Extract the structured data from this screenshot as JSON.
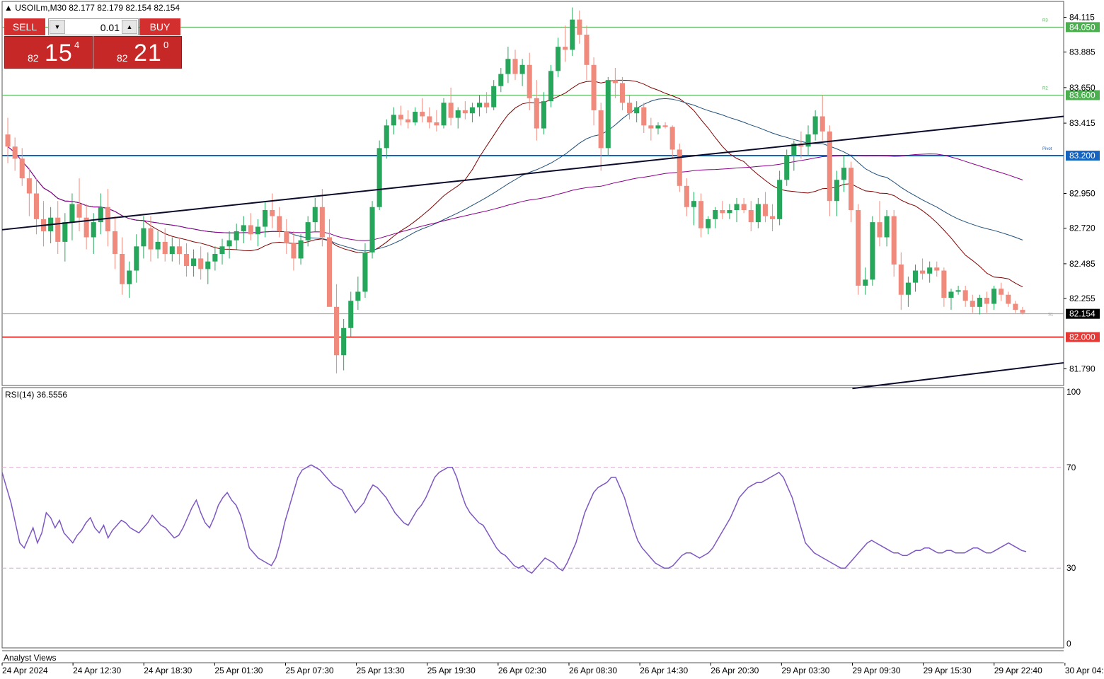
{
  "header": {
    "symbol_line": "USOILm,M30  82.177 82.179 82.154 82.154",
    "triangle_icon": "triangle-up-icon"
  },
  "trade_panel": {
    "sell_label": "SELL",
    "buy_label": "BUY",
    "volume": "0.01",
    "sell_price": {
      "small": "82",
      "big": "15",
      "sup": "4"
    },
    "buy_price": {
      "small": "82",
      "big": "21",
      "sup": "0"
    },
    "colors": {
      "button": "#d32f2f",
      "price_box": "#c62828"
    }
  },
  "indicator": {
    "rsi_label": "RSI(14) 36.5556"
  },
  "footer": {
    "analyst_label": "Analyst Views"
  },
  "chart_data": {
    "type": "candlestick",
    "symbol": "USOILm",
    "timeframe": "M30",
    "ylim": [
      81.68,
      84.22
    ],
    "y_ticks": [
      "84.115",
      "83.885",
      "83.650",
      "83.415",
      "82.950",
      "82.720",
      "82.485",
      "82.255",
      "81.790"
    ],
    "x_labels": [
      "24 Apr 2024",
      "24 Apr 12:30",
      "24 Apr 18:30",
      "25 Apr 01:30",
      "25 Apr 07:30",
      "25 Apr 13:30",
      "25 Apr 19:30",
      "26 Apr 02:30",
      "26 Apr 08:30",
      "26 Apr 14:30",
      "26 Apr 20:30",
      "29 Apr 03:30",
      "29 Apr 09:30",
      "29 Apr 15:30",
      "29 Apr 22:40",
      "30 Apr 04:30"
    ],
    "candle_count": 248,
    "candles_ohlc": [
      [
        83.34,
        83.45,
        83.15,
        83.26
      ],
      [
        83.26,
        83.32,
        83.1,
        83.18
      ],
      [
        83.18,
        83.25,
        83.0,
        83.05
      ],
      [
        83.05,
        83.12,
        82.8,
        82.95
      ],
      [
        82.95,
        83.05,
        82.68,
        82.78
      ],
      [
        82.78,
        82.9,
        82.6,
        82.7
      ],
      [
        82.7,
        82.86,
        82.62,
        82.79
      ],
      [
        82.79,
        82.9,
        82.55,
        82.63
      ],
      [
        82.63,
        82.82,
        82.5,
        82.76
      ],
      [
        82.76,
        82.95,
        82.64,
        82.88
      ],
      [
        82.88,
        83.05,
        82.7,
        82.79
      ],
      [
        82.79,
        82.88,
        82.58,
        82.66
      ],
      [
        82.66,
        82.82,
        82.55,
        82.76
      ],
      [
        82.76,
        82.95,
        82.68,
        82.86
      ],
      [
        82.86,
        82.98,
        82.6,
        82.7
      ],
      [
        82.7,
        82.8,
        82.45,
        82.55
      ],
      [
        82.55,
        82.66,
        82.28,
        82.35
      ],
      [
        82.35,
        82.5,
        82.26,
        82.44
      ],
      [
        82.44,
        82.68,
        82.36,
        82.6
      ],
      [
        82.6,
        82.8,
        82.52,
        82.72
      ],
      [
        82.72,
        82.8,
        82.5,
        82.58
      ],
      [
        82.58,
        82.7,
        82.52,
        82.63
      ],
      [
        82.63,
        82.72,
        82.5,
        82.55
      ],
      [
        82.55,
        82.66,
        82.5,
        82.6
      ],
      [
        82.6,
        82.66,
        82.48,
        82.55
      ],
      [
        82.55,
        82.62,
        82.4,
        82.47
      ],
      [
        82.47,
        82.58,
        82.4,
        82.52
      ],
      [
        82.52,
        82.6,
        82.38,
        82.45
      ],
      [
        82.45,
        82.56,
        82.35,
        82.5
      ],
      [
        82.5,
        82.6,
        82.44,
        82.55
      ],
      [
        82.55,
        82.65,
        82.48,
        82.6
      ],
      [
        82.6,
        82.7,
        82.52,
        82.64
      ],
      [
        82.64,
        82.75,
        82.58,
        82.7
      ],
      [
        82.7,
        82.8,
        82.62,
        82.74
      ],
      [
        82.74,
        82.82,
        82.64,
        82.68
      ],
      [
        82.68,
        82.78,
        82.6,
        82.73
      ],
      [
        82.73,
        82.9,
        82.66,
        82.84
      ],
      [
        82.84,
        82.95,
        82.72,
        82.8
      ],
      [
        82.8,
        82.86,
        82.66,
        82.7
      ],
      [
        82.7,
        82.78,
        82.55,
        82.62
      ],
      [
        82.62,
        82.7,
        82.44,
        82.52
      ],
      [
        82.52,
        82.68,
        82.48,
        82.64
      ],
      [
        82.64,
        82.8,
        82.6,
        82.76
      ],
      [
        82.76,
        82.92,
        82.7,
        82.86
      ],
      [
        82.86,
        82.98,
        82.6,
        82.66
      ],
      [
        82.66,
        82.78,
        82.3,
        82.2
      ],
      [
        82.2,
        82.35,
        81.76,
        81.88
      ],
      [
        81.88,
        82.12,
        81.78,
        82.06
      ],
      [
        82.06,
        82.3,
        82.0,
        82.24
      ],
      [
        82.24,
        82.4,
        82.18,
        82.3
      ],
      [
        82.3,
        82.62,
        82.26,
        82.56
      ],
      [
        82.56,
        82.9,
        82.52,
        82.86
      ],
      [
        82.86,
        83.3,
        82.84,
        83.25
      ],
      [
        83.25,
        83.44,
        83.18,
        83.4
      ],
      [
        83.4,
        83.52,
        83.34,
        83.47
      ],
      [
        83.47,
        83.53,
        83.4,
        83.44
      ],
      [
        83.44,
        83.5,
        83.38,
        83.42
      ],
      [
        83.42,
        83.52,
        83.4,
        83.49
      ],
      [
        83.49,
        83.58,
        83.42,
        83.46
      ],
      [
        83.46,
        83.52,
        83.38,
        83.42
      ],
      [
        83.42,
        83.5,
        83.36,
        83.4
      ],
      [
        83.4,
        83.58,
        83.38,
        83.55
      ],
      [
        83.55,
        83.65,
        83.4,
        83.45
      ],
      [
        83.45,
        83.52,
        83.38,
        83.5
      ],
      [
        83.5,
        83.56,
        83.44,
        83.48
      ],
      [
        83.48,
        83.55,
        83.42,
        83.52
      ],
      [
        83.52,
        83.6,
        83.46,
        83.55
      ],
      [
        83.55,
        83.62,
        83.48,
        83.52
      ],
      [
        83.52,
        83.7,
        83.5,
        83.66
      ],
      [
        83.66,
        83.78,
        83.62,
        83.74
      ],
      [
        83.74,
        83.92,
        83.68,
        83.84
      ],
      [
        83.84,
        83.9,
        83.7,
        83.74
      ],
      [
        83.74,
        83.84,
        83.66,
        83.8
      ],
      [
        83.8,
        83.88,
        83.5,
        83.58
      ],
      [
        83.58,
        83.7,
        83.3,
        83.38
      ],
      [
        83.38,
        83.62,
        83.34,
        83.56
      ],
      [
        83.56,
        83.8,
        83.52,
        83.76
      ],
      [
        83.76,
        83.98,
        83.72,
        83.92
      ],
      [
        83.92,
        84.06,
        83.82,
        83.9
      ],
      [
        83.9,
        84.18,
        83.86,
        84.1
      ],
      [
        84.1,
        84.16,
        83.94,
        84.0
      ],
      [
        84.0,
        84.06,
        83.7,
        83.8
      ],
      [
        83.8,
        83.85,
        83.4,
        83.5
      ],
      [
        83.5,
        83.55,
        83.1,
        83.25
      ],
      [
        83.25,
        83.72,
        83.2,
        83.7
      ],
      [
        83.7,
        83.78,
        83.58,
        83.68
      ],
      [
        83.68,
        83.72,
        83.5,
        83.55
      ],
      [
        83.55,
        83.6,
        83.44,
        83.48
      ],
      [
        83.48,
        83.56,
        83.42,
        83.52
      ],
      [
        83.52,
        83.55,
        83.35,
        83.4
      ],
      [
        83.4,
        83.45,
        83.3,
        83.38
      ],
      [
        83.38,
        83.42,
        83.34,
        83.4
      ],
      [
        83.4,
        83.42,
        83.38,
        83.39
      ],
      [
        83.39,
        83.4,
        83.18,
        83.24
      ],
      [
        83.24,
        83.28,
        82.96,
        83.0
      ],
      [
        83.0,
        83.05,
        82.8,
        82.86
      ],
      [
        82.86,
        82.96,
        82.74,
        82.9
      ],
      [
        82.9,
        82.95,
        82.66,
        82.72
      ],
      [
        82.72,
        82.8,
        82.68,
        82.78
      ],
      [
        82.78,
        82.86,
        82.72,
        82.84
      ],
      [
        82.84,
        82.9,
        82.78,
        82.82
      ],
      [
        82.82,
        82.88,
        82.78,
        82.84
      ],
      [
        82.84,
        82.92,
        82.76,
        82.88
      ],
      [
        82.88,
        82.92,
        82.82,
        82.84
      ],
      [
        82.84,
        82.9,
        82.7,
        82.76
      ],
      [
        82.76,
        82.92,
        82.72,
        82.88
      ],
      [
        82.88,
        82.96,
        82.76,
        82.8
      ],
      [
        82.8,
        82.88,
        82.7,
        82.78
      ],
      [
        82.78,
        83.1,
        82.74,
        83.04
      ],
      [
        83.04,
        83.24,
        83.0,
        83.2
      ],
      [
        83.2,
        83.3,
        83.1,
        83.28
      ],
      [
        83.28,
        83.36,
        83.18,
        83.26
      ],
      [
        83.26,
        83.4,
        83.2,
        83.34
      ],
      [
        83.34,
        83.5,
        83.3,
        83.46
      ],
      [
        83.46,
        83.6,
        83.3,
        83.36
      ],
      [
        83.36,
        83.4,
        82.8,
        82.9
      ],
      [
        82.9,
        83.1,
        82.8,
        83.04
      ],
      [
        83.04,
        83.2,
        82.96,
        83.12
      ],
      [
        83.12,
        83.16,
        82.76,
        82.84
      ],
      [
        82.84,
        82.88,
        82.28,
        82.34
      ],
      [
        82.34,
        82.46,
        82.28,
        82.38
      ],
      [
        82.38,
        82.8,
        82.34,
        82.76
      ],
      [
        82.76,
        82.9,
        82.6,
        82.66
      ],
      [
        82.66,
        82.84,
        82.6,
        82.8
      ],
      [
        82.8,
        82.84,
        82.4,
        82.48
      ],
      [
        82.48,
        82.56,
        82.18,
        82.28
      ],
      [
        82.28,
        82.4,
        82.2,
        82.36
      ],
      [
        82.36,
        82.48,
        82.3,
        82.44
      ],
      [
        82.44,
        82.52,
        82.38,
        82.42
      ],
      [
        82.42,
        82.5,
        82.36,
        82.46
      ],
      [
        82.46,
        82.5,
        82.4,
        82.44
      ],
      [
        82.44,
        82.46,
        82.2,
        82.26
      ],
      [
        82.26,
        82.32,
        82.18,
        82.3
      ],
      [
        82.3,
        82.34,
        82.28,
        82.31
      ],
      [
        82.31,
        82.34,
        82.2,
        82.24
      ],
      [
        82.24,
        82.28,
        82.16,
        82.2
      ],
      [
        82.2,
        82.28,
        82.15,
        82.26
      ],
      [
        82.26,
        82.3,
        82.16,
        82.22
      ],
      [
        82.22,
        82.34,
        82.18,
        82.32
      ],
      [
        82.32,
        82.36,
        82.24,
        82.28
      ],
      [
        82.28,
        82.3,
        82.2,
        82.22
      ],
      [
        82.22,
        82.24,
        82.16,
        82.18
      ],
      [
        82.18,
        82.2,
        82.15,
        82.16
      ]
    ],
    "levels": [
      {
        "label": "84.050",
        "value": 84.05,
        "color": "#4caf50",
        "tag": "R3"
      },
      {
        "label": "83.600",
        "value": 83.6,
        "color": "#4caf50",
        "tag": "R2"
      },
      {
        "label": "83.200",
        "value": 83.2,
        "color": "#1565c0",
        "tag": "Pivot"
      },
      {
        "label": "82.000",
        "value": 82.0,
        "color": "#e53935",
        "tag": ""
      }
    ],
    "current_price": {
      "label": "82.154",
      "value": 82.154,
      "tag": "S1"
    },
    "rsi": {
      "period": 14,
      "ylim": [
        0,
        100
      ],
      "levels": [
        70,
        30
      ],
      "y_ticks": [
        "100",
        "70",
        "30",
        "0"
      ],
      "values": [
        68,
        62,
        56,
        48,
        40,
        38,
        42,
        46,
        40,
        44,
        52,
        50,
        46,
        49,
        44,
        42,
        40,
        43,
        45,
        48,
        50,
        46,
        44,
        47,
        42,
        45,
        47,
        49,
        48,
        46,
        45,
        44,
        46,
        48,
        51,
        49,
        47,
        46,
        44,
        42,
        43,
        46,
        50,
        54,
        57,
        52,
        48,
        46,
        50,
        55,
        58,
        60,
        57,
        55,
        51,
        45,
        38,
        36,
        34,
        33,
        32,
        31,
        34,
        40,
        48,
        54,
        60,
        66,
        69,
        70,
        71,
        70,
        69,
        67,
        65,
        63,
        62,
        61,
        58,
        55,
        52,
        54,
        56,
        60,
        63,
        62,
        60,
        58,
        55,
        52,
        50,
        48,
        47,
        50,
        53,
        55,
        58,
        62,
        66,
        68,
        69,
        70,
        70,
        66,
        60,
        55,
        52,
        50,
        48,
        47,
        44,
        41,
        38,
        36,
        35,
        33,
        31,
        30,
        31,
        29,
        28,
        30,
        32,
        34,
        33,
        32,
        30,
        29,
        32,
        36,
        40,
        46,
        52,
        56,
        60,
        62,
        63,
        64,
        66,
        66,
        62,
        58,
        52,
        46,
        41,
        38,
        36,
        34,
        32,
        31,
        30,
        30,
        31,
        33,
        35,
        36,
        36,
        35,
        34,
        35,
        36,
        38,
        41,
        44,
        47,
        50,
        54,
        58,
        60,
        62,
        63,
        64,
        64,
        65,
        66,
        67,
        68,
        66,
        62,
        58,
        52,
        46,
        40,
        38,
        36,
        35,
        34,
        33,
        32,
        31,
        30,
        30,
        32,
        34,
        36,
        38,
        40,
        41,
        40,
        39,
        38,
        37,
        36,
        36,
        35,
        35,
        36,
        37,
        37,
        38,
        38,
        37,
        36,
        36,
        37,
        37,
        36,
        36,
        36,
        37,
        38,
        38,
        37,
        36,
        36,
        37,
        38,
        39,
        40,
        39,
        38,
        37,
        36.5556
      ]
    },
    "moving_averages": [
      {
        "color": "#800000"
      },
      {
        "color": "#1f4e79"
      },
      {
        "color": "#8b008b"
      }
    ],
    "trendlines": [
      {
        "from": [
          "24 Apr 2024",
          82.71
        ],
        "to": [
          "30 Apr 04:30",
          83.46
        ],
        "color": "#0a0a2a"
      },
      {
        "from": [
          "29 Apr 09:30",
          81.66
        ],
        "to": [
          "30 Apr 04:30",
          81.83
        ],
        "color": "#0a0a2a"
      }
    ]
  }
}
